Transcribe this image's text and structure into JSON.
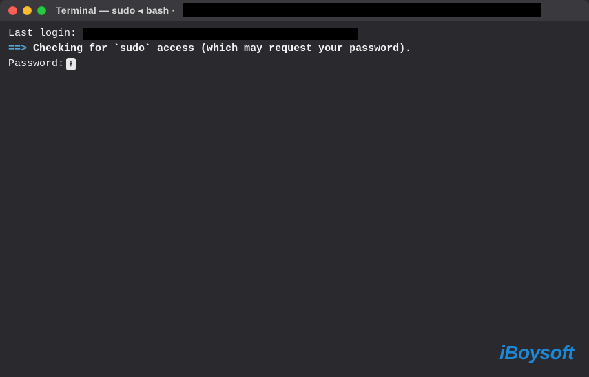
{
  "titlebar": {
    "title": "Terminal — sudo ◂ bash ·"
  },
  "content": {
    "last_login_label": "Last login:",
    "arrow": "==>",
    "check_message": " Checking for `sudo` access (which may request your password).",
    "password_label": "Password:"
  },
  "watermark": {
    "text": "iBoysoft"
  }
}
